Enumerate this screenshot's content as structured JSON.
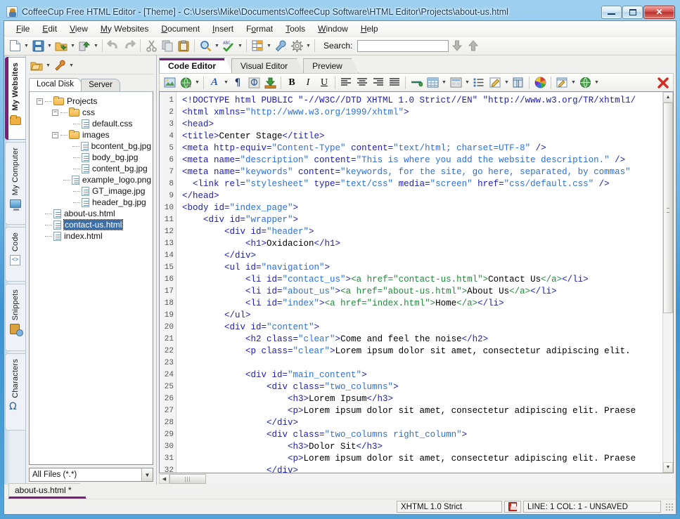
{
  "window": {
    "title": "CoffeeCup Free HTML Editor - [Theme] - C:\\Users\\Mike\\Documents\\CoffeeCup Software\\HTML Editor\\Projects\\about-us.html",
    "icon": "app-icon",
    "buttons": {
      "minimize": "minimize",
      "maximize": "maximize",
      "close": "✕"
    }
  },
  "menubar": [
    {
      "label": "File",
      "accel": "F"
    },
    {
      "label": "Edit",
      "accel": "E"
    },
    {
      "label": "View",
      "accel": "V"
    },
    {
      "label": "My Websites",
      "accel": "M"
    },
    {
      "label": "Document",
      "accel": "D"
    },
    {
      "label": "Insert",
      "accel": "I"
    },
    {
      "label": "Format",
      "accel": "o"
    },
    {
      "label": "Tools",
      "accel": "T"
    },
    {
      "label": "Window",
      "accel": "W"
    },
    {
      "label": "Help",
      "accel": "H"
    }
  ],
  "toolbar": {
    "items": [
      {
        "name": "new-document-icon",
        "dropdown": true
      },
      {
        "name": "save-icon",
        "dropdown": true
      },
      {
        "name": "open-project-icon",
        "dropdown": true
      },
      {
        "name": "upload-icon",
        "dropdown": true
      },
      {
        "name": "undo-icon",
        "dropdown": false
      },
      {
        "name": "redo-icon",
        "dropdown": false
      },
      {
        "name": "cut-icon",
        "dropdown": false
      },
      {
        "name": "copy-icon",
        "dropdown": false
      },
      {
        "name": "paste-icon",
        "dropdown": false
      },
      {
        "name": "find-icon",
        "dropdown": true
      },
      {
        "name": "spellcheck-icon",
        "dropdown": true
      },
      {
        "name": "insert-table-icon",
        "dropdown": true
      },
      {
        "name": "tools-wrench-icon",
        "dropdown": false
      },
      {
        "name": "settings-gear-icon",
        "dropdown": true
      }
    ],
    "search_label": "Search:",
    "search_value": "",
    "search_placeholder": "",
    "find_next": "find-next-icon",
    "find_prev": "find-previous-icon"
  },
  "sidebar": {
    "vertical_tabs": [
      {
        "label": "My Websites",
        "icon": "folder-icon",
        "active": true
      },
      {
        "label": "My Computer",
        "icon": "monitor-icon",
        "active": false
      },
      {
        "label": "Code",
        "icon": "code-file-icon",
        "active": false
      },
      {
        "label": "Snippets",
        "icon": "snippets-clipboard-icon",
        "active": false
      },
      {
        "label": "Characters",
        "icon": "omega-icon",
        "active": false
      }
    ]
  },
  "file_panel": {
    "toolbar": [
      {
        "name": "open-folder-icon",
        "dropdown": true
      },
      {
        "name": "settings-wrench-icon",
        "dropdown": true
      }
    ],
    "tabs": [
      {
        "label": "Local Disk",
        "active": true
      },
      {
        "label": "Server",
        "active": false
      }
    ],
    "tree": [
      {
        "label": "Projects",
        "depth": 0,
        "type": "folder",
        "expanded": true,
        "selected": false
      },
      {
        "label": "css",
        "depth": 1,
        "type": "folder",
        "expanded": true,
        "selected": false
      },
      {
        "label": "default.css",
        "depth": 2,
        "type": "file",
        "expanded": false,
        "selected": false
      },
      {
        "label": "images",
        "depth": 1,
        "type": "folder",
        "expanded": true,
        "selected": false
      },
      {
        "label": "bcontent_bg.jpg",
        "depth": 2,
        "type": "file",
        "expanded": false,
        "selected": false
      },
      {
        "label": "body_bg.jpg",
        "depth": 2,
        "type": "file",
        "expanded": false,
        "selected": false
      },
      {
        "label": "content_bg.jpg",
        "depth": 2,
        "type": "file",
        "expanded": false,
        "selected": false
      },
      {
        "label": "example_logo.png",
        "depth": 2,
        "type": "file",
        "expanded": false,
        "selected": false
      },
      {
        "label": "GT_image.jpg",
        "depth": 2,
        "type": "file",
        "expanded": false,
        "selected": false
      },
      {
        "label": "header_bg.jpg",
        "depth": 2,
        "type": "file",
        "expanded": false,
        "selected": false
      },
      {
        "label": "about-us.html",
        "depth": 1,
        "type": "file",
        "expanded": false,
        "selected": false
      },
      {
        "label": "contact-us.html",
        "depth": 1,
        "type": "file",
        "expanded": false,
        "selected": true
      },
      {
        "label": "index.html",
        "depth": 1,
        "type": "file",
        "expanded": false,
        "selected": false
      }
    ],
    "filter": {
      "value": "All Files (*.*)"
    }
  },
  "editor": {
    "tabs": [
      {
        "label": "Code Editor",
        "active": true
      },
      {
        "label": "Visual Editor",
        "active": false
      },
      {
        "label": "Preview",
        "active": false
      }
    ],
    "toolbar": [
      {
        "name": "insert-image-icon",
        "dropdown": false
      },
      {
        "name": "insert-media-icon",
        "dropdown": true
      },
      {
        "name": "font-icon",
        "dropdown": true
      },
      {
        "name": "paragraph-icon",
        "dropdown": false
      },
      {
        "name": "insert-anchor-icon",
        "dropdown": false
      },
      {
        "name": "insert-download-icon",
        "dropdown": false
      },
      {
        "name": "bold-icon",
        "dropdown": false
      },
      {
        "name": "italic-icon",
        "dropdown": false
      },
      {
        "name": "underline-icon",
        "dropdown": false
      },
      {
        "name": "align-left-icon",
        "dropdown": false
      },
      {
        "name": "align-center-icon",
        "dropdown": false
      },
      {
        "name": "align-right-icon",
        "dropdown": false
      },
      {
        "name": "align-justify-icon",
        "dropdown": false
      },
      {
        "name": "horizontal-rule-icon",
        "dropdown": false
      },
      {
        "name": "insert-table-icon",
        "dropdown": true
      },
      {
        "name": "layout-div-icon",
        "dropdown": true
      },
      {
        "name": "bullet-list-icon",
        "dropdown": false
      },
      {
        "name": "edit-form-icon",
        "dropdown": true
      },
      {
        "name": "frames-icon",
        "dropdown": false
      },
      {
        "name": "color-picker-icon",
        "dropdown": false
      },
      {
        "name": "edit-page-icon",
        "dropdown": true
      },
      {
        "name": "globe-preview-icon",
        "dropdown": true
      },
      {
        "name": "close-document-icon",
        "dropdown": false
      }
    ],
    "first_line": 1,
    "line_numbers": [
      1,
      2,
      3,
      4,
      5,
      6,
      7,
      8,
      9,
      10,
      11,
      12,
      13,
      14,
      15,
      16,
      17,
      18,
      19,
      20,
      21,
      22,
      23,
      24,
      25,
      26,
      27,
      28,
      29,
      30,
      31,
      32
    ],
    "code_lines": [
      [
        {
          "t": "tag",
          "v": "<!DOCTYPE html PUBLIC \"-//W3C//DTD XHTML 1.0 Strict//EN\" \"http://www.w3.org/TR/xhtml1/"
        }
      ],
      [
        {
          "t": "tag",
          "v": "<html xmlns="
        },
        {
          "t": "atv",
          "v": "\"http://www.w3.org/1999/xhtml\""
        },
        {
          "t": "tag",
          "v": ">"
        }
      ],
      [
        {
          "t": "tag",
          "v": "<head>"
        }
      ],
      [
        {
          "t": "tag",
          "v": "<title>"
        },
        {
          "t": "txt",
          "v": "Center Stage"
        },
        {
          "t": "tag",
          "v": "</title>"
        }
      ],
      [
        {
          "t": "tag",
          "v": "<meta http-equiv="
        },
        {
          "t": "atv",
          "v": "\"Content-Type\""
        },
        {
          "t": "tag",
          "v": " content="
        },
        {
          "t": "atv",
          "v": "\"text/html; charset=UTF-8\""
        },
        {
          "t": "tag",
          "v": " />"
        }
      ],
      [
        {
          "t": "tag",
          "v": "<meta name="
        },
        {
          "t": "atv",
          "v": "\"description\""
        },
        {
          "t": "tag",
          "v": " content="
        },
        {
          "t": "atv",
          "v": "\"This is where you add the website description.\""
        },
        {
          "t": "tag",
          "v": " />"
        }
      ],
      [
        {
          "t": "tag",
          "v": "<meta name="
        },
        {
          "t": "atv",
          "v": "\"keywords\""
        },
        {
          "t": "tag",
          "v": " content="
        },
        {
          "t": "atv",
          "v": "\"keywords, for the site, go here, separated, by commas\""
        }
      ],
      [
        {
          "t": "tag",
          "v": "  <link rel="
        },
        {
          "t": "atv",
          "v": "\"stylesheet\""
        },
        {
          "t": "tag",
          "v": " type="
        },
        {
          "t": "atv",
          "v": "\"text/css\""
        },
        {
          "t": "tag",
          "v": " media="
        },
        {
          "t": "atv",
          "v": "\"screen\""
        },
        {
          "t": "tag",
          "v": " href="
        },
        {
          "t": "atv",
          "v": "\"css/default.css\""
        },
        {
          "t": "tag",
          "v": " />"
        }
      ],
      [
        {
          "t": "tag",
          "v": "</head>"
        }
      ],
      [
        {
          "t": "tag",
          "v": "<body id="
        },
        {
          "t": "atv",
          "v": "\"index_page\""
        },
        {
          "t": "tag",
          "v": ">"
        }
      ],
      [
        {
          "t": "tag",
          "v": "    <div id="
        },
        {
          "t": "atv",
          "v": "\"wrapper\""
        },
        {
          "t": "tag",
          "v": ">"
        }
      ],
      [
        {
          "t": "tag",
          "v": "        <div id="
        },
        {
          "t": "atv",
          "v": "\"header\""
        },
        {
          "t": "tag",
          "v": ">"
        }
      ],
      [
        {
          "t": "tag",
          "v": "            <h1>"
        },
        {
          "t": "txt",
          "v": "Oxidacion"
        },
        {
          "t": "tag",
          "v": "</h1>"
        }
      ],
      [
        {
          "t": "tag",
          "v": "        </div>"
        }
      ],
      [
        {
          "t": "tag",
          "v": "        <ul id="
        },
        {
          "t": "atv",
          "v": "\"navigation\""
        },
        {
          "t": "tag",
          "v": ">"
        }
      ],
      [
        {
          "t": "tag",
          "v": "            <li id="
        },
        {
          "t": "atv",
          "v": "\"contact_us\""
        },
        {
          "t": "tag",
          "v": ">"
        },
        {
          "t": "atag",
          "v": "<a href="
        },
        {
          "t": "atag",
          "v": "\"contact-us.html\""
        },
        {
          "t": "atag",
          "v": ">"
        },
        {
          "t": "txt",
          "v": "Contact Us"
        },
        {
          "t": "atag",
          "v": "</a>"
        },
        {
          "t": "tag",
          "v": "</li>"
        }
      ],
      [
        {
          "t": "tag",
          "v": "            <li id="
        },
        {
          "t": "atv",
          "v": "\"about_us\""
        },
        {
          "t": "tag",
          "v": ">"
        },
        {
          "t": "atag",
          "v": "<a href="
        },
        {
          "t": "atag",
          "v": "\"about-us.html\""
        },
        {
          "t": "atag",
          "v": ">"
        },
        {
          "t": "txt",
          "v": "About Us"
        },
        {
          "t": "atag",
          "v": "</a>"
        },
        {
          "t": "tag",
          "v": "</li>"
        }
      ],
      [
        {
          "t": "tag",
          "v": "            <li id="
        },
        {
          "t": "atv",
          "v": "\"index\""
        },
        {
          "t": "tag",
          "v": ">"
        },
        {
          "t": "atag",
          "v": "<a href="
        },
        {
          "t": "atag",
          "v": "\"index.html\""
        },
        {
          "t": "atag",
          "v": ">"
        },
        {
          "t": "txt",
          "v": "Home"
        },
        {
          "t": "atag",
          "v": "</a>"
        },
        {
          "t": "tag",
          "v": "</li>"
        }
      ],
      [
        {
          "t": "tag",
          "v": "        </ul>"
        }
      ],
      [
        {
          "t": "tag",
          "v": "        <div id="
        },
        {
          "t": "atv",
          "v": "\"content\""
        },
        {
          "t": "tag",
          "v": ">"
        }
      ],
      [
        {
          "t": "tag",
          "v": "            <h2 class="
        },
        {
          "t": "atv",
          "v": "\"clear\""
        },
        {
          "t": "tag",
          "v": ">"
        },
        {
          "t": "txt",
          "v": "Come and feel the noise"
        },
        {
          "t": "tag",
          "v": "</h2>"
        }
      ],
      [
        {
          "t": "tag",
          "v": "            <p class="
        },
        {
          "t": "atv",
          "v": "\"clear\""
        },
        {
          "t": "tag",
          "v": ">"
        },
        {
          "t": "txt",
          "v": "Lorem ipsum dolor sit amet, consectetur adipiscing elit."
        }
      ],
      [
        {
          "t": "txt",
          "v": ""
        }
      ],
      [
        {
          "t": "tag",
          "v": "            <div id="
        },
        {
          "t": "atv",
          "v": "\"main_content\""
        },
        {
          "t": "tag",
          "v": ">"
        }
      ],
      [
        {
          "t": "tag",
          "v": "                <div class="
        },
        {
          "t": "atv",
          "v": "\"two_columns\""
        },
        {
          "t": "tag",
          "v": ">"
        }
      ],
      [
        {
          "t": "tag",
          "v": "                    <h3>"
        },
        {
          "t": "txt",
          "v": "Lorem Ipsum"
        },
        {
          "t": "tag",
          "v": "</h3>"
        }
      ],
      [
        {
          "t": "tag",
          "v": "                    <p>"
        },
        {
          "t": "txt",
          "v": "Lorem ipsum dolor sit amet, consectetur adipiscing elit. Praese"
        }
      ],
      [
        {
          "t": "tag",
          "v": "                </div>"
        }
      ],
      [
        {
          "t": "tag",
          "v": "                <div class="
        },
        {
          "t": "atv",
          "v": "\"two_columns right_column\""
        },
        {
          "t": "tag",
          "v": ">"
        }
      ],
      [
        {
          "t": "tag",
          "v": "                    <h3>"
        },
        {
          "t": "txt",
          "v": "Dolor Sit"
        },
        {
          "t": "tag",
          "v": "</h3>"
        }
      ],
      [
        {
          "t": "tag",
          "v": "                    <p>"
        },
        {
          "t": "txt",
          "v": "Lorem ipsum dolor sit amet, consectetur adipiscing elit. Praese"
        }
      ],
      [
        {
          "t": "tag",
          "v": "                </div>"
        }
      ]
    ]
  },
  "document_tabs": [
    {
      "label": "about-us.html *",
      "active": true
    }
  ],
  "statusbar": {
    "doctype": "XHTML 1.0 Strict",
    "save_icon": "unsaved-floppy-icon",
    "position": "LINE: 1  COL: 1 - UNSAVED"
  },
  "colors": {
    "accent_purple": "#7b1f7b",
    "tag_blue": "#1b1bb5",
    "attr_value_blue": "#2a6fe0",
    "anchor_green": "#1f8a3a",
    "selection_blue": "#3a6ea5",
    "title_blue": "#123b5e"
  }
}
